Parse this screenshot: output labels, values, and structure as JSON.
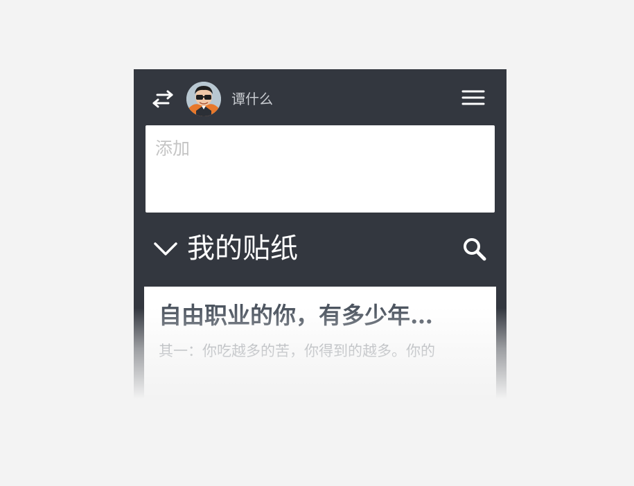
{
  "header": {
    "switch_icon": "swap-arrows-icon",
    "avatar_icon": "user-avatar",
    "username": "谭什么",
    "menu_icon": "hamburger-menu-icon"
  },
  "add_note": {
    "placeholder": "添加",
    "value": ""
  },
  "section": {
    "collapse_icon": "chevron-down-icon",
    "title": "我的贴纸",
    "search_icon": "search-icon"
  },
  "notes": [
    {
      "title": "自由职业的你，有多少年…",
      "excerpt": "其一：你吃越多的苦，你得到的越多。你的"
    }
  ],
  "colors": {
    "page_background": "#f3f3f3",
    "app_background": "#33373f",
    "card_background": "#ffffff",
    "title_text": "#4d5560",
    "excerpt_text": "#8f949a"
  }
}
